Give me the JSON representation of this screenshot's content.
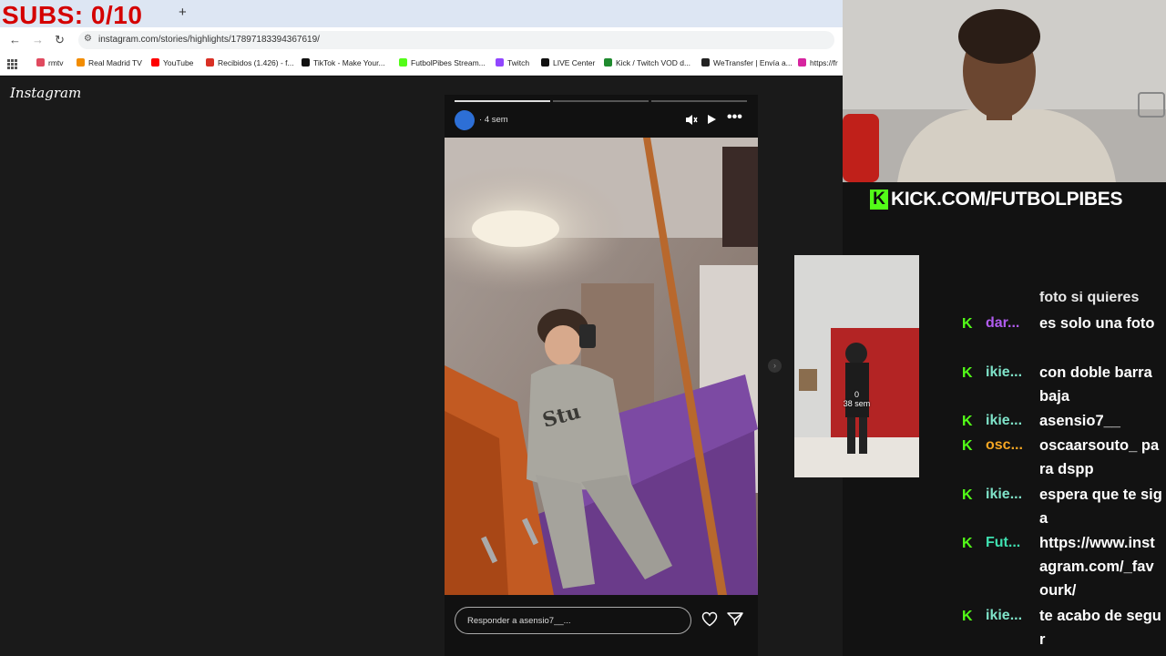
{
  "overlay": {
    "subs_counter": "SUBS: 0/10",
    "kick_url": "KICK.COM/FUTBOLPIBES"
  },
  "browser": {
    "new_tab": "+",
    "url": "instagram.com/stories/highlights/17897183394367619/",
    "bookmarks": [
      {
        "label": "rmtv",
        "color": "#e04a5f"
      },
      {
        "label": "Real Madrid TV",
        "color": "#f28c00"
      },
      {
        "label": "YouTube",
        "color": "#ff0000"
      },
      {
        "label": "Recibidos (1.426) - f...",
        "color": "#d93025"
      },
      {
        "label": "TikTok - Make Your...",
        "color": "#111111"
      },
      {
        "label": "FutbolPibes Stream...",
        "color": "#53fc18"
      },
      {
        "label": "Twitch",
        "color": "#9146ff"
      },
      {
        "label": "LIVE Center",
        "color": "#111111"
      },
      {
        "label": "Kick / Twitch VOD d...",
        "color": "#1f8a2e"
      },
      {
        "label": "WeTransfer | Envía a...",
        "color": "#222222"
      },
      {
        "label": "https://fr",
        "color": "#d6249f"
      }
    ]
  },
  "instagram": {
    "logo": "Instagram",
    "story": {
      "time": "4 sem",
      "reply_placeholder": "Responder a asensio7__...",
      "progress_done": 1,
      "progress_total": 3
    },
    "prev_story": {
      "views": "0",
      "time": "38 sem"
    }
  },
  "chat": {
    "cut_top": "foto si quieres",
    "messages": [
      {
        "user": "dar...",
        "color": "#b15cf0",
        "text": "es solo una foto",
        "lines": 2
      },
      {
        "user": "ikie...",
        "color": "#7fe3c9",
        "text": "con doble barra baja",
        "lines": 2
      },
      {
        "user": "ikie...",
        "color": "#7fe3c9",
        "text": "asensio7__",
        "lines": 1
      },
      {
        "user": "osc...",
        "color": "#f5a623",
        "text": "oscaarsouto_ para dspp",
        "lines": 2
      },
      {
        "user": "ikie...",
        "color": "#7fe3c9",
        "text": "espera que te siga",
        "lines": 2
      },
      {
        "user": "Fut...",
        "color": "#3fe0b0",
        "text": "https://www.instagram.com/_favourk/",
        "lines": 3
      },
      {
        "user": "ikie...",
        "color": "#7fe3c9",
        "text": "te acabo de segur",
        "lines": 2
      }
    ]
  }
}
